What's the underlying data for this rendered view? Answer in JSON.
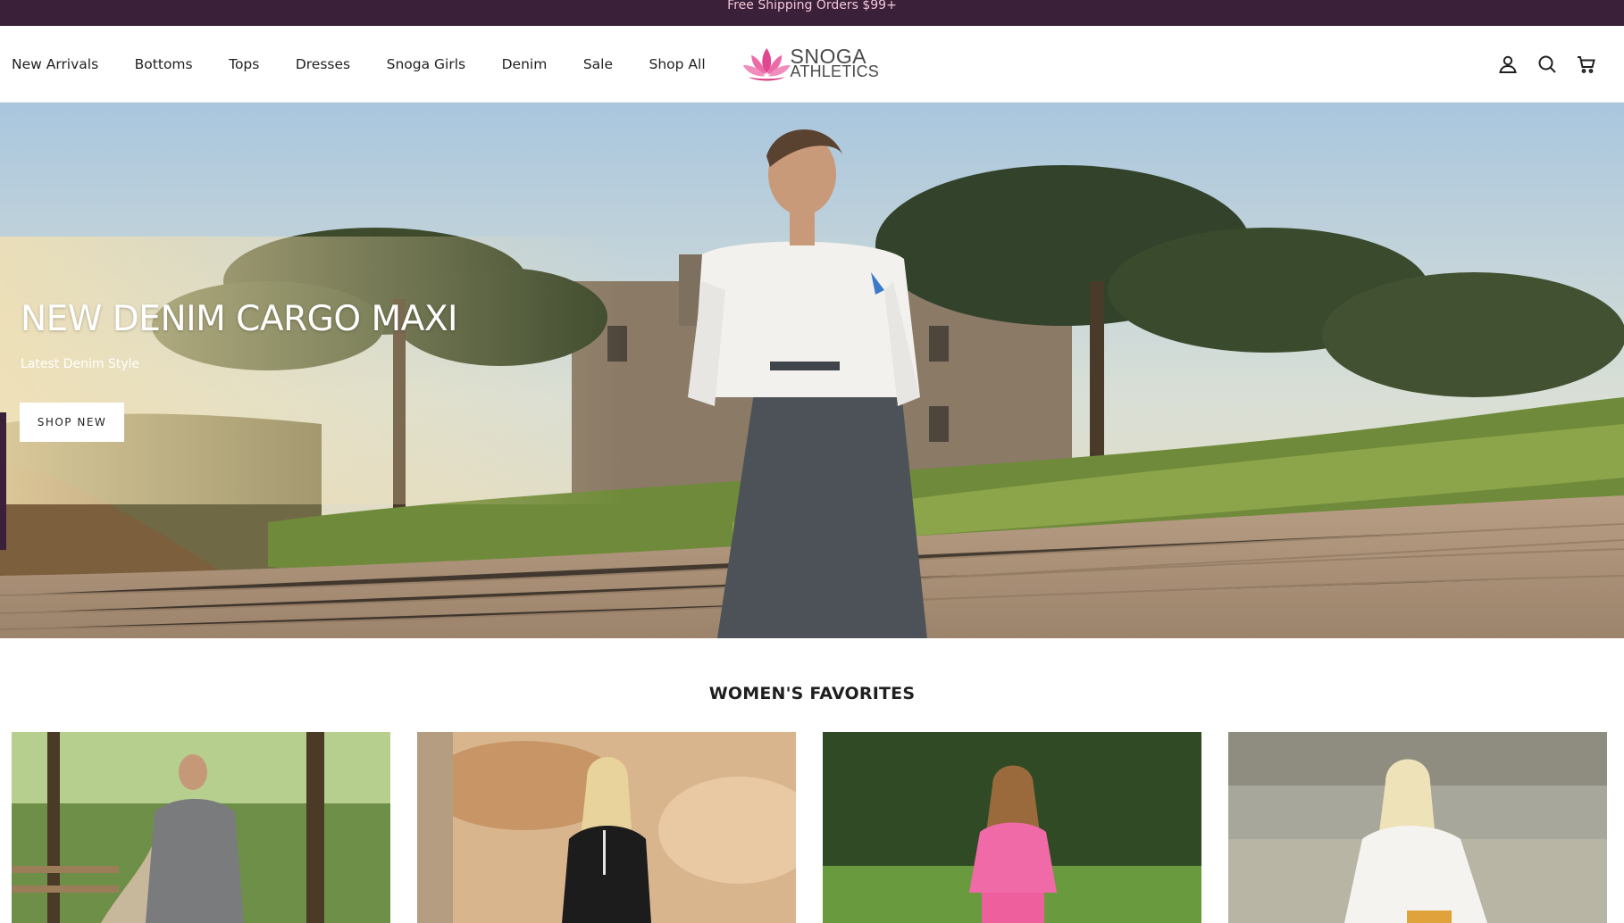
{
  "announcement": {
    "text": "Free Shipping Orders $99+"
  },
  "nav": {
    "items": [
      {
        "label": "New Arrivals"
      },
      {
        "label": "Bottoms"
      },
      {
        "label": "Tops"
      },
      {
        "label": "Dresses"
      },
      {
        "label": "Snoga Girls"
      },
      {
        "label": "Denim"
      },
      {
        "label": "Sale"
      },
      {
        "label": "Shop All"
      }
    ]
  },
  "brand": {
    "line1": "SNOGA",
    "line2": "ATHLETICS",
    "accent_color": "#e1478f"
  },
  "header_icons": [
    "account-icon",
    "search-icon",
    "cart-icon"
  ],
  "hero": {
    "title": "NEW DENIM CARGO MAXI",
    "subtitle": "Latest Denim Style",
    "button_label": "SHOP NEW"
  },
  "favorites": {
    "title": "WOMEN'S FAVORITES"
  },
  "colors": {
    "announcement_bg": "#3a2038",
    "announcement_text": "#f3c6d8"
  }
}
